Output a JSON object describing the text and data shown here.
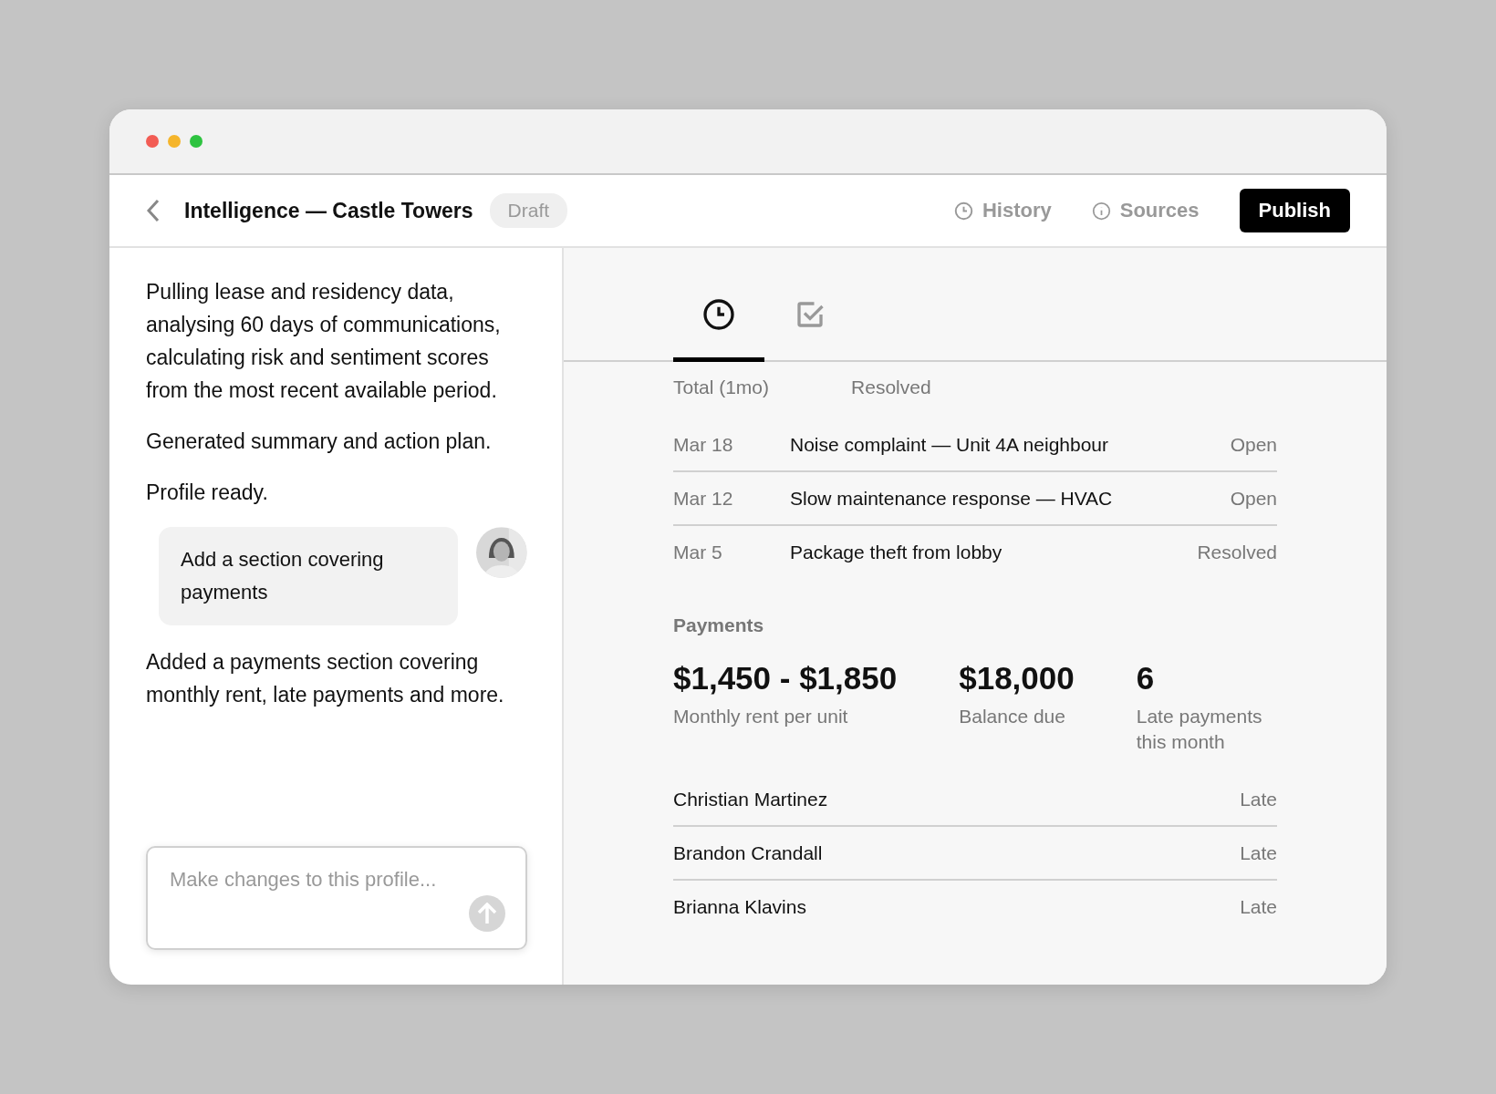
{
  "window": {
    "title": "Intelligence — Castle Towers",
    "badge": "Draft"
  },
  "header_actions": [
    {
      "kind": "history",
      "label": "History"
    },
    {
      "kind": "sources",
      "label": "Sources"
    }
  ],
  "publish": "Publish",
  "chat": {
    "messages": [
      {
        "kind": "assistant",
        "text": "Pulling lease and residency data, analysing 60 days of communications, calculating risk and sentiment scores from the most recent available period."
      },
      {
        "kind": "assistant",
        "text": "Generated summary and action plan."
      },
      {
        "kind": "assistant",
        "text": "Profile ready."
      },
      {
        "kind": "user",
        "text": "Add a section covering payments"
      },
      {
        "kind": "assistant",
        "text": "Added a payments section covering monthly rent, late payments and more."
      }
    ],
    "input": {
      "placeholder": "Make changes to this profile..."
    }
  },
  "tabs": [
    {
      "kind": "history",
      "selected": true
    },
    {
      "kind": "tasks",
      "selected": false
    }
  ],
  "summary_labels": [
    "Total (1mo)",
    "Resolved"
  ],
  "issues": [
    {
      "date": "Mar 18",
      "title": "Noise complaint — Unit 4A neighbour",
      "status": "Open"
    },
    {
      "date": "Mar 12",
      "title": "Slow maintenance response — HVAC",
      "status": "Open"
    },
    {
      "date": "Mar 5",
      "title": "Package theft from lobby",
      "status": "Resolved"
    }
  ],
  "payments": {
    "title": "Payments",
    "stats": [
      {
        "value": "$1,450 - $1,850",
        "label": "Monthly rent per unit"
      },
      {
        "value": "$18,000",
        "label": "Balance due"
      },
      {
        "value": "6",
        "label": "Late payments this month"
      }
    ],
    "tenants": [
      {
        "name": "Christian Martinez",
        "status": "Late"
      },
      {
        "name": "Brandon Crandall",
        "status": "Late"
      },
      {
        "name": "Brianna Klavins",
        "status": "Late"
      }
    ]
  }
}
